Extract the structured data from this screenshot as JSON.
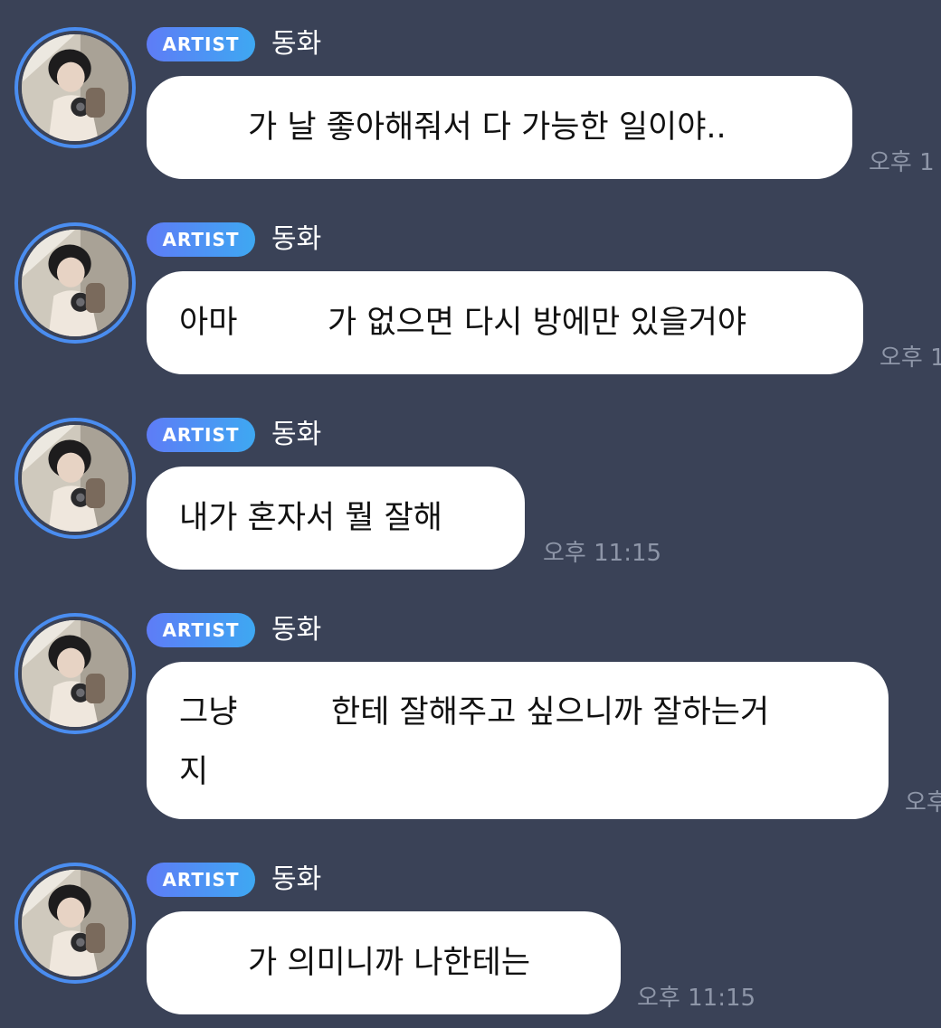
{
  "messages": [
    {
      "badge": "ARTIST",
      "name": "동화",
      "lines": [
        "가 날 좋아해줘서 다 가능한 일이야.."
      ],
      "time": "오후 1"
    },
    {
      "badge": "ARTIST",
      "name": "동화",
      "lines": [
        "아마",
        "가 없으면 다시 방에만 있을거야"
      ],
      "time": "오후 1"
    },
    {
      "badge": "ARTIST",
      "name": "동화",
      "lines": [
        "내가 혼자서 뭘 잘해"
      ],
      "time": "오후 11:15"
    },
    {
      "badge": "ARTIST",
      "name": "동화",
      "lines": [
        "그냥",
        "한테 잘해주고 싶으니까 잘하는거",
        "지"
      ],
      "time": "오후"
    },
    {
      "badge": "ARTIST",
      "name": "동화",
      "lines": [
        "가 의미니까 나한테는"
      ],
      "time": "오후 11:15"
    }
  ],
  "colors": {
    "background": "#3a4257",
    "avatar_ring": "#4a8df0",
    "badge_start": "#5e7cf6",
    "badge_end": "#3ea8f2",
    "bubble": "#ffffff",
    "timestamp": "#8e96a8"
  }
}
